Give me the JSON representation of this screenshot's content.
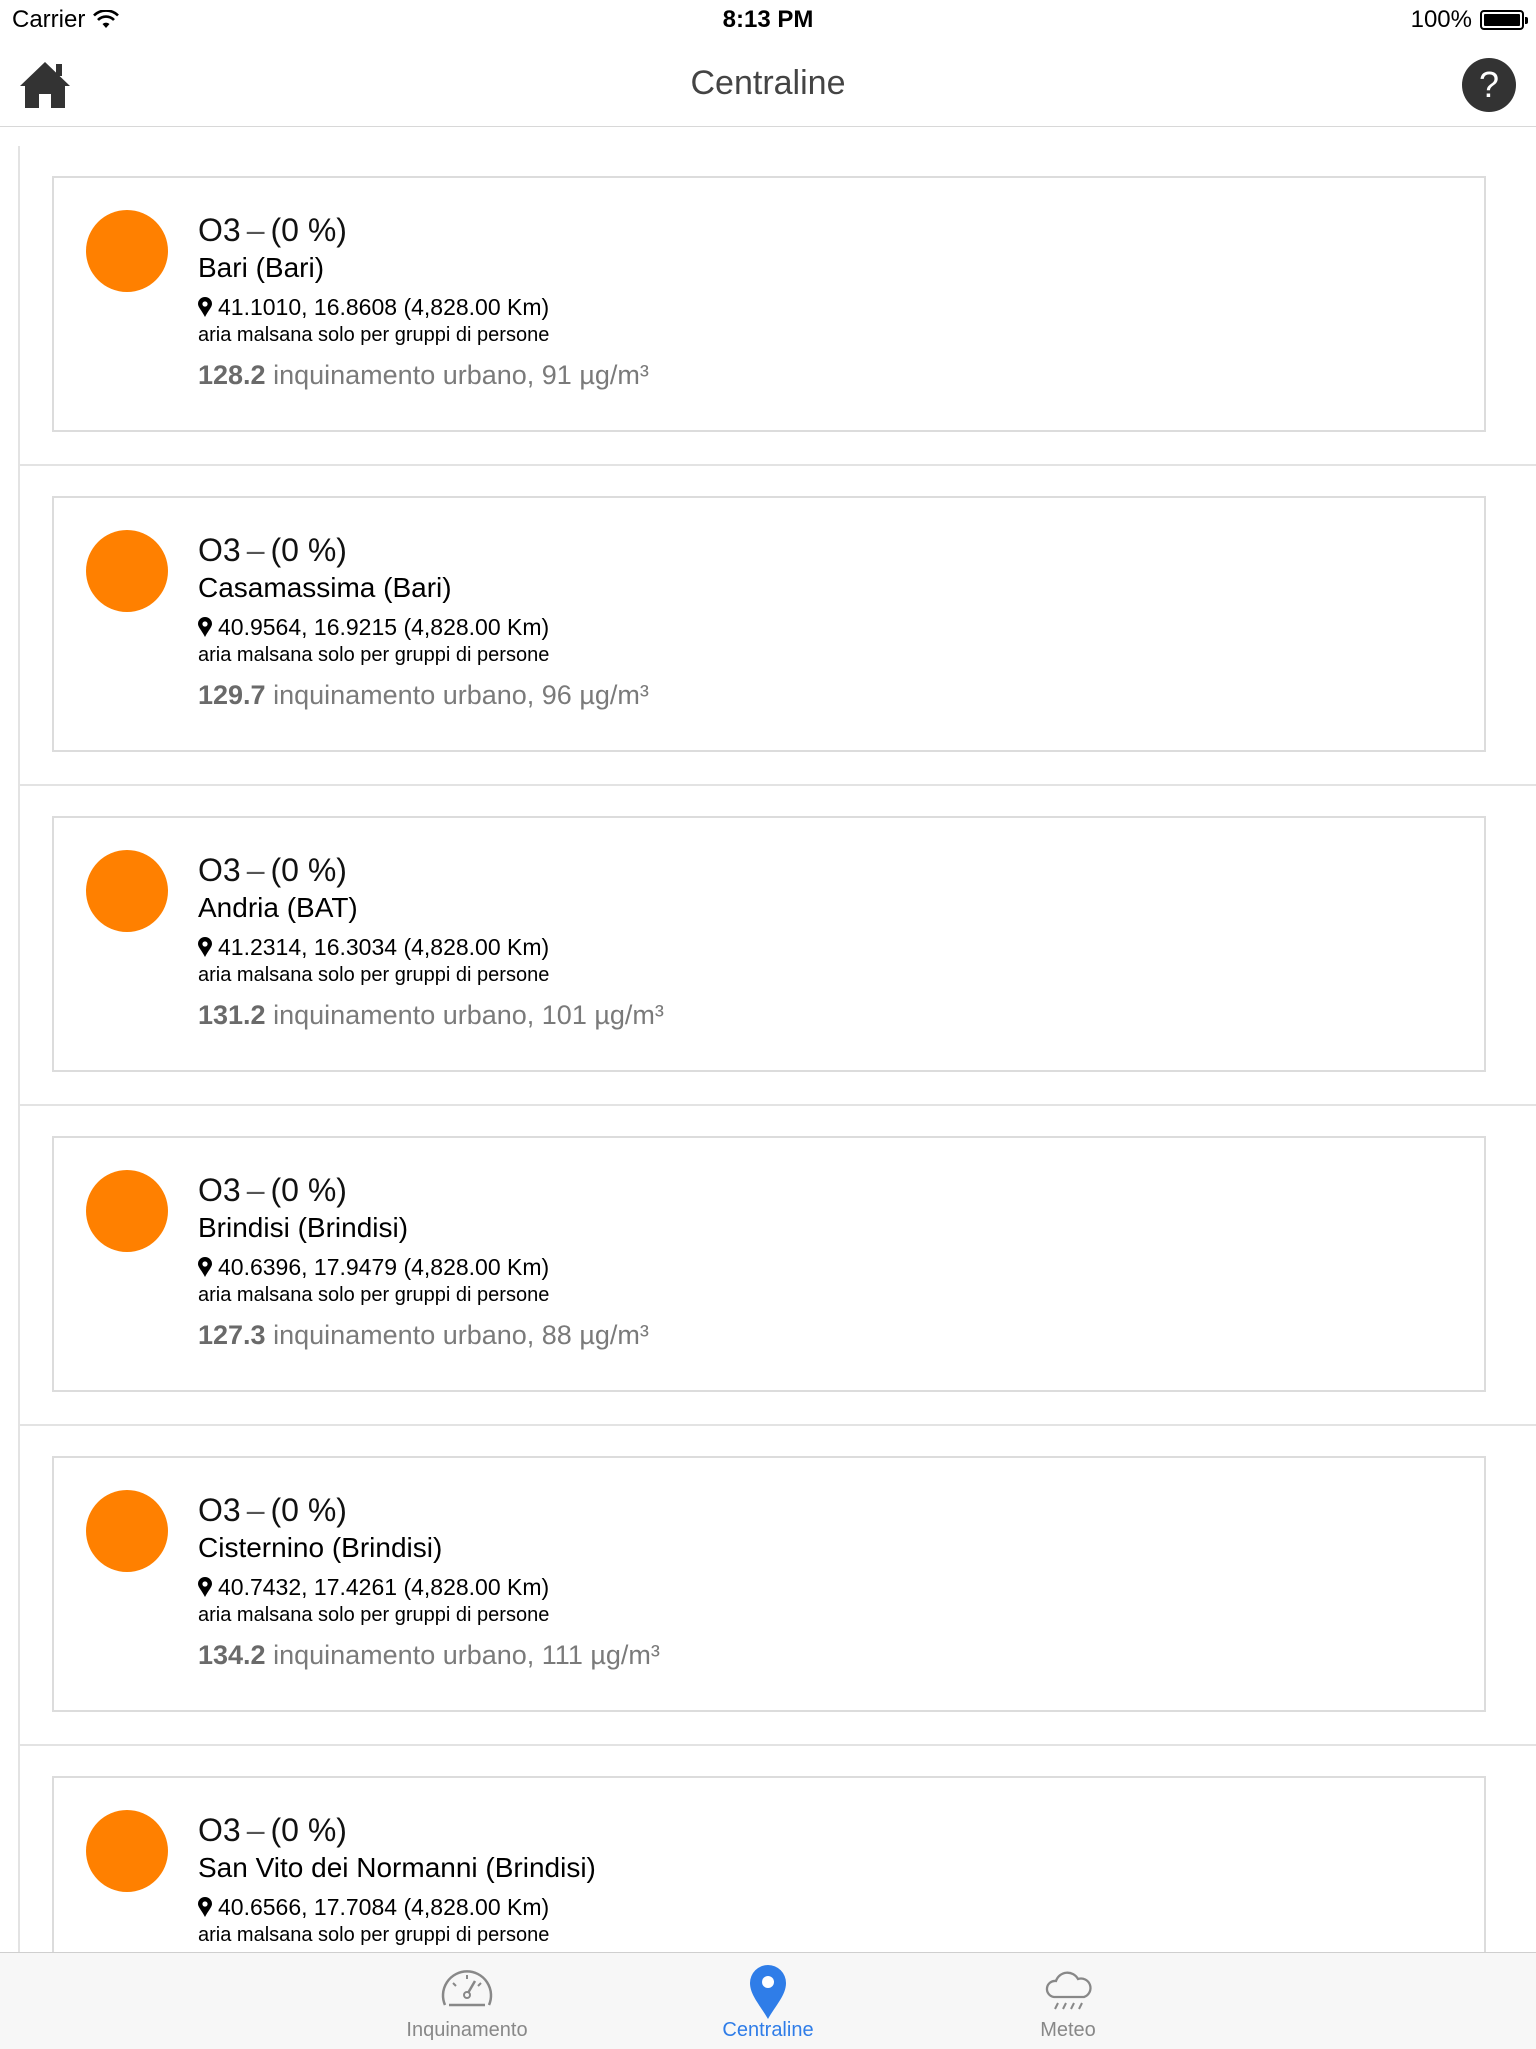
{
  "status_bar": {
    "carrier": "Carrier",
    "time": "8:13 PM",
    "battery": "100%"
  },
  "nav": {
    "title": "Centraline",
    "help_label": "?"
  },
  "colors": {
    "marker": "#ff8000",
    "accent": "#2f7de8",
    "tab_inactive": "#888888"
  },
  "stations": [
    {
      "pollutant": "O3",
      "percent": "(0 %)",
      "name": "Bari (Bari)",
      "coords": "41.1010, 16.8608 (4,828.00 Km)",
      "quality": "aria malsana solo per gruppi di persone",
      "index": "128.2",
      "detail": "inquinamento urbano, 91 µg/m³"
    },
    {
      "pollutant": "O3",
      "percent": "(0 %)",
      "name": "Casamassima (Bari)",
      "coords": "40.9564, 16.9215 (4,828.00 Km)",
      "quality": "aria malsana solo per gruppi di persone",
      "index": "129.7",
      "detail": "inquinamento urbano, 96 µg/m³"
    },
    {
      "pollutant": "O3",
      "percent": "(0 %)",
      "name": "Andria (BAT)",
      "coords": "41.2314, 16.3034 (4,828.00 Km)",
      "quality": "aria malsana solo per gruppi di persone",
      "index": "131.2",
      "detail": "inquinamento urbano, 101 µg/m³"
    },
    {
      "pollutant": "O3",
      "percent": "(0 %)",
      "name": "Brindisi (Brindisi)",
      "coords": "40.6396, 17.9479 (4,828.00 Km)",
      "quality": "aria malsana solo per gruppi di persone",
      "index": "127.3",
      "detail": "inquinamento urbano, 88 µg/m³"
    },
    {
      "pollutant": "O3",
      "percent": "(0 %)",
      "name": "Cisternino (Brindisi)",
      "coords": "40.7432, 17.4261 (4,828.00 Km)",
      "quality": "aria malsana solo per gruppi di persone",
      "index": "134.2",
      "detail": "inquinamento urbano, 111 µg/m³"
    },
    {
      "pollutant": "O3",
      "percent": "(0 %)",
      "name": "San Vito dei Normanni (Brindisi)",
      "coords": "40.6566, 17.7084 (4,828.00 Km)",
      "quality": "aria malsana solo per gruppi di persone",
      "index": "",
      "detail": ""
    }
  ],
  "tabs": [
    {
      "label": "Inquinamento",
      "icon": "speedometer-icon",
      "active": false
    },
    {
      "label": "Centraline",
      "icon": "map-pin-icon",
      "active": true
    },
    {
      "label": "Meteo",
      "icon": "rain-cloud-icon",
      "active": false
    }
  ]
}
